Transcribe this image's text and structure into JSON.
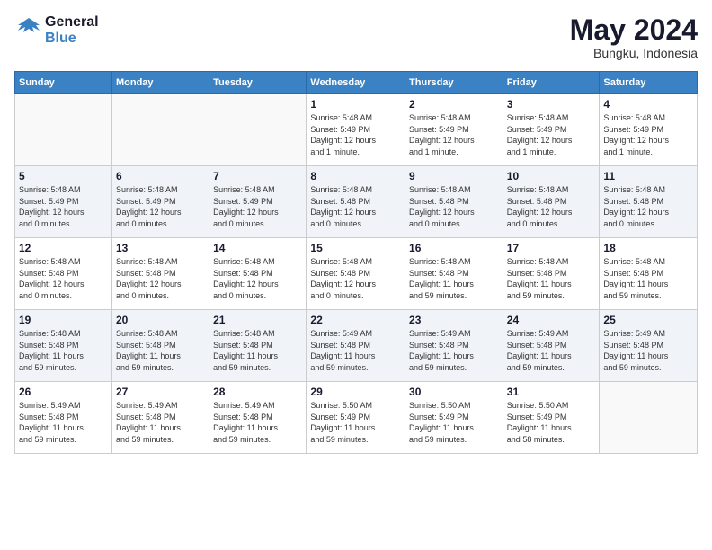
{
  "header": {
    "logo_general": "General",
    "logo_blue": "Blue",
    "month": "May 2024",
    "location": "Bungku, Indonesia"
  },
  "weekdays": [
    "Sunday",
    "Monday",
    "Tuesday",
    "Wednesday",
    "Thursday",
    "Friday",
    "Saturday"
  ],
  "weeks": [
    [
      {
        "day": "",
        "info": ""
      },
      {
        "day": "",
        "info": ""
      },
      {
        "day": "",
        "info": ""
      },
      {
        "day": "1",
        "info": "Sunrise: 5:48 AM\nSunset: 5:49 PM\nDaylight: 12 hours\nand 1 minute."
      },
      {
        "day": "2",
        "info": "Sunrise: 5:48 AM\nSunset: 5:49 PM\nDaylight: 12 hours\nand 1 minute."
      },
      {
        "day": "3",
        "info": "Sunrise: 5:48 AM\nSunset: 5:49 PM\nDaylight: 12 hours\nand 1 minute."
      },
      {
        "day": "4",
        "info": "Sunrise: 5:48 AM\nSunset: 5:49 PM\nDaylight: 12 hours\nand 1 minute."
      }
    ],
    [
      {
        "day": "5",
        "info": "Sunrise: 5:48 AM\nSunset: 5:49 PM\nDaylight: 12 hours\nand 0 minutes."
      },
      {
        "day": "6",
        "info": "Sunrise: 5:48 AM\nSunset: 5:49 PM\nDaylight: 12 hours\nand 0 minutes."
      },
      {
        "day": "7",
        "info": "Sunrise: 5:48 AM\nSunset: 5:49 PM\nDaylight: 12 hours\nand 0 minutes."
      },
      {
        "day": "8",
        "info": "Sunrise: 5:48 AM\nSunset: 5:48 PM\nDaylight: 12 hours\nand 0 minutes."
      },
      {
        "day": "9",
        "info": "Sunrise: 5:48 AM\nSunset: 5:48 PM\nDaylight: 12 hours\nand 0 minutes."
      },
      {
        "day": "10",
        "info": "Sunrise: 5:48 AM\nSunset: 5:48 PM\nDaylight: 12 hours\nand 0 minutes."
      },
      {
        "day": "11",
        "info": "Sunrise: 5:48 AM\nSunset: 5:48 PM\nDaylight: 12 hours\nand 0 minutes."
      }
    ],
    [
      {
        "day": "12",
        "info": "Sunrise: 5:48 AM\nSunset: 5:48 PM\nDaylight: 12 hours\nand 0 minutes."
      },
      {
        "day": "13",
        "info": "Sunrise: 5:48 AM\nSunset: 5:48 PM\nDaylight: 12 hours\nand 0 minutes."
      },
      {
        "day": "14",
        "info": "Sunrise: 5:48 AM\nSunset: 5:48 PM\nDaylight: 12 hours\nand 0 minutes."
      },
      {
        "day": "15",
        "info": "Sunrise: 5:48 AM\nSunset: 5:48 PM\nDaylight: 12 hours\nand 0 minutes."
      },
      {
        "day": "16",
        "info": "Sunrise: 5:48 AM\nSunset: 5:48 PM\nDaylight: 11 hours\nand 59 minutes."
      },
      {
        "day": "17",
        "info": "Sunrise: 5:48 AM\nSunset: 5:48 PM\nDaylight: 11 hours\nand 59 minutes."
      },
      {
        "day": "18",
        "info": "Sunrise: 5:48 AM\nSunset: 5:48 PM\nDaylight: 11 hours\nand 59 minutes."
      }
    ],
    [
      {
        "day": "19",
        "info": "Sunrise: 5:48 AM\nSunset: 5:48 PM\nDaylight: 11 hours\nand 59 minutes."
      },
      {
        "day": "20",
        "info": "Sunrise: 5:48 AM\nSunset: 5:48 PM\nDaylight: 11 hours\nand 59 minutes."
      },
      {
        "day": "21",
        "info": "Sunrise: 5:48 AM\nSunset: 5:48 PM\nDaylight: 11 hours\nand 59 minutes."
      },
      {
        "day": "22",
        "info": "Sunrise: 5:49 AM\nSunset: 5:48 PM\nDaylight: 11 hours\nand 59 minutes."
      },
      {
        "day": "23",
        "info": "Sunrise: 5:49 AM\nSunset: 5:48 PM\nDaylight: 11 hours\nand 59 minutes."
      },
      {
        "day": "24",
        "info": "Sunrise: 5:49 AM\nSunset: 5:48 PM\nDaylight: 11 hours\nand 59 minutes."
      },
      {
        "day": "25",
        "info": "Sunrise: 5:49 AM\nSunset: 5:48 PM\nDaylight: 11 hours\nand 59 minutes."
      }
    ],
    [
      {
        "day": "26",
        "info": "Sunrise: 5:49 AM\nSunset: 5:48 PM\nDaylight: 11 hours\nand 59 minutes."
      },
      {
        "day": "27",
        "info": "Sunrise: 5:49 AM\nSunset: 5:48 PM\nDaylight: 11 hours\nand 59 minutes."
      },
      {
        "day": "28",
        "info": "Sunrise: 5:49 AM\nSunset: 5:48 PM\nDaylight: 11 hours\nand 59 minutes."
      },
      {
        "day": "29",
        "info": "Sunrise: 5:50 AM\nSunset: 5:49 PM\nDaylight: 11 hours\nand 59 minutes."
      },
      {
        "day": "30",
        "info": "Sunrise: 5:50 AM\nSunset: 5:49 PM\nDaylight: 11 hours\nand 59 minutes."
      },
      {
        "day": "31",
        "info": "Sunrise: 5:50 AM\nSunset: 5:49 PM\nDaylight: 11 hours\nand 58 minutes."
      },
      {
        "day": "",
        "info": ""
      }
    ]
  ]
}
